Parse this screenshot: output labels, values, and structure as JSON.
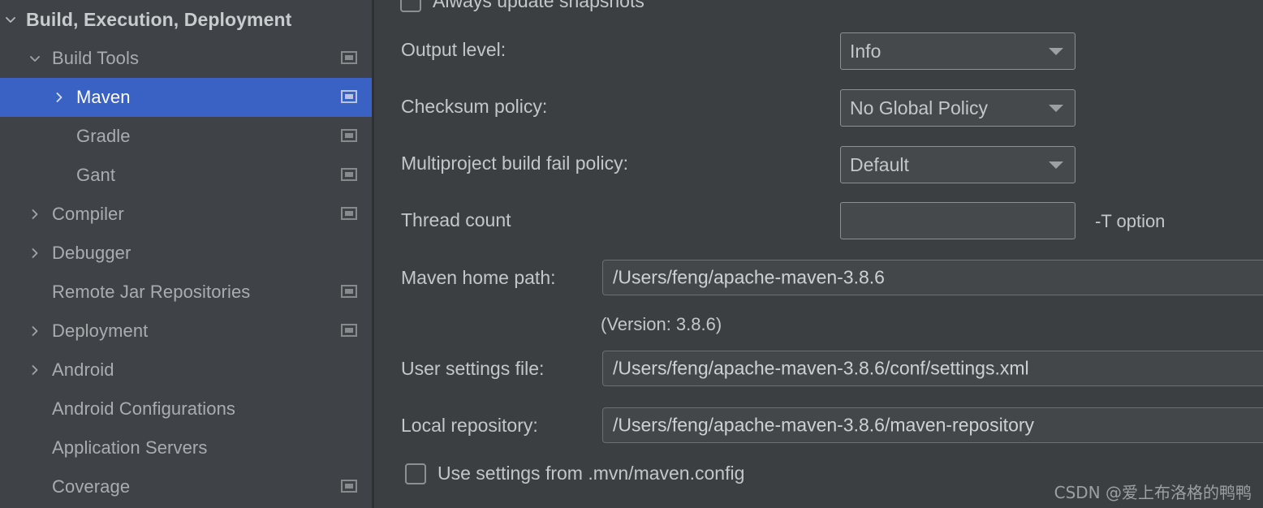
{
  "window": {
    "theme_accent": "#3a62c4",
    "background": "#3c3f41",
    "sidebar_background": "#3f4347"
  },
  "sidebar": {
    "items": [
      {
        "label": "Build, Execution, Deployment",
        "indent": 0,
        "chevron": "chevron-down-icon",
        "icon": null,
        "selected": false,
        "bold": true
      },
      {
        "label": "Build Tools",
        "indent": 1,
        "chevron": "chevron-down-icon",
        "icon": "settings-page-icon",
        "selected": false,
        "bold": false
      },
      {
        "label": "Maven",
        "indent": 2,
        "chevron": "chevron-right-icon",
        "icon": "settings-page-icon",
        "selected": true,
        "bold": false
      },
      {
        "label": "Gradle",
        "indent": 2,
        "chevron": null,
        "icon": "settings-page-icon",
        "selected": false,
        "bold": false
      },
      {
        "label": "Gant",
        "indent": 2,
        "chevron": null,
        "icon": "settings-page-icon",
        "selected": false,
        "bold": false
      },
      {
        "label": "Compiler",
        "indent": 1,
        "chevron": "chevron-right-icon",
        "icon": "settings-page-icon",
        "selected": false,
        "bold": false
      },
      {
        "label": "Debugger",
        "indent": 1,
        "chevron": "chevron-right-icon",
        "icon": null,
        "selected": false,
        "bold": false
      },
      {
        "label": "Remote Jar Repositories",
        "indent": 1,
        "chevron": null,
        "icon": "settings-page-icon",
        "selected": false,
        "bold": false
      },
      {
        "label": "Deployment",
        "indent": 1,
        "chevron": "chevron-right-icon",
        "icon": "settings-page-icon",
        "selected": false,
        "bold": false
      },
      {
        "label": "Android",
        "indent": 1,
        "chevron": "chevron-right-icon",
        "icon": null,
        "selected": false,
        "bold": false
      },
      {
        "label": "Android Configurations",
        "indent": 1,
        "chevron": null,
        "icon": null,
        "selected": false,
        "bold": false
      },
      {
        "label": "Application Servers",
        "indent": 1,
        "chevron": null,
        "icon": null,
        "selected": false,
        "bold": false
      },
      {
        "label": "Coverage",
        "indent": 1,
        "chevron": null,
        "icon": "settings-page-icon",
        "selected": false,
        "bold": false
      }
    ]
  },
  "maven_settings": {
    "always_update_snapshots": {
      "label": "Always update snapshots",
      "checked": false
    },
    "output_level": {
      "label": "Output level:",
      "value": "Info"
    },
    "checksum_policy": {
      "label": "Checksum policy:",
      "value": "No Global Policy"
    },
    "multiproject_build_fail_policy": {
      "label": "Multiproject build fail policy:",
      "value": "Default"
    },
    "thread_count": {
      "label": "Thread count",
      "value": "",
      "hint": "-T option"
    },
    "maven_home_path": {
      "label": "Maven home path:",
      "value": "/Users/feng/apache-maven-3.8.6"
    },
    "version_note": "(Version: 3.8.6)",
    "user_settings_file": {
      "label": "User settings file:",
      "value": "/Users/feng/apache-maven-3.8.6/conf/settings.xml"
    },
    "local_repository": {
      "label": "Local repository:",
      "value": "/Users/feng/apache-maven-3.8.6/maven-repository"
    },
    "use_settings_from_mvn_config": {
      "label": "Use settings from .mvn/maven.config",
      "checked": false
    }
  },
  "watermark": "CSDN @爱上布洛格的鸭鸭"
}
